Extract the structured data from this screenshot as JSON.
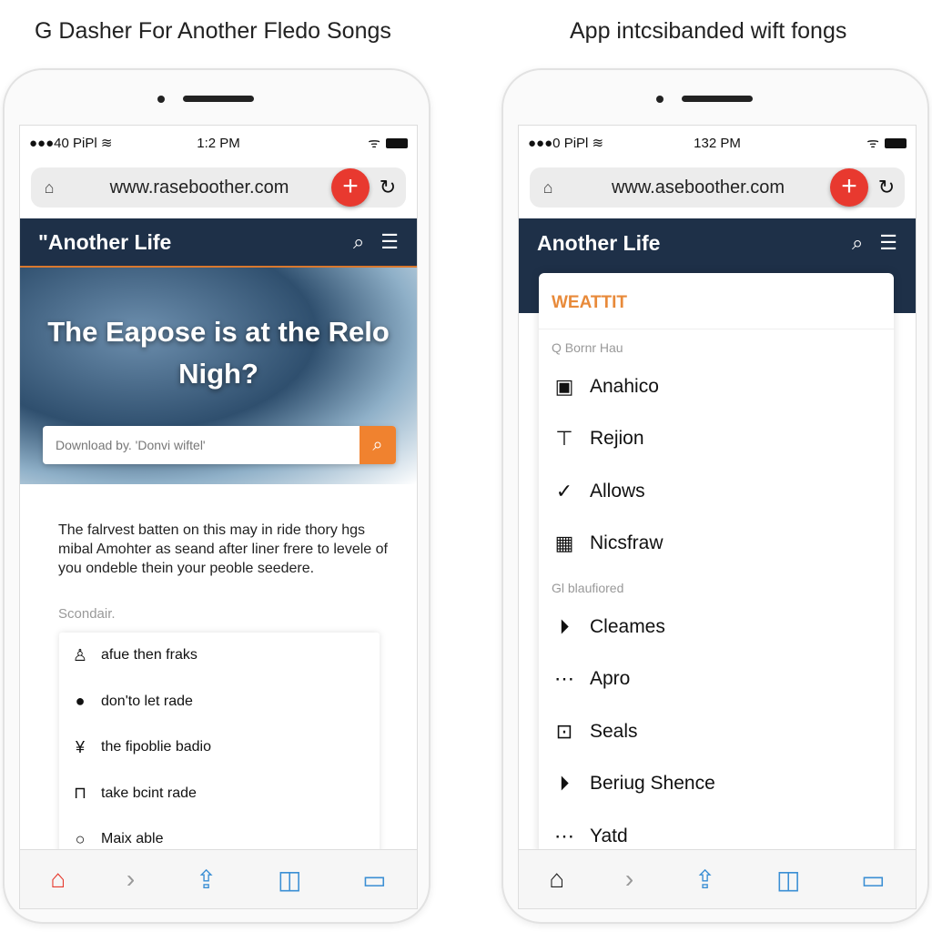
{
  "left": {
    "caption": "G Dasher For Another Fledo Songs",
    "status": {
      "carrier": "●●●40 PiPl",
      "time": "1:2 PM"
    },
    "url": "www.raseboother.com",
    "nav_title": "\"Another Life",
    "hero_title": "The Eapose is at the Relo Nigh?",
    "search_placeholder": "Download by. 'Donvi wiftel'",
    "paragraph": "The falrvest batten on this may in ride thory hgs mibal Amohter as seand after liner frere to levele of you ondeble thein your peoble seedere.",
    "secondary": "Scondair.",
    "items": [
      {
        "label": "afue then fraks",
        "icon": "user-icon"
      },
      {
        "label": "don'to let rade",
        "icon": "pin-icon"
      },
      {
        "label": "the fipoblie badio",
        "icon": "antenna-icon"
      },
      {
        "label": "take bcint rade",
        "icon": "stand-icon"
      },
      {
        "label": "Maix able",
        "icon": "circle-icon"
      }
    ]
  },
  "right": {
    "caption": "App intcsibanded wift fongs",
    "status": {
      "carrier": "●●●0 PiPl",
      "time": "132 PM"
    },
    "url": "www.aseboother.com",
    "nav_title": "Another Life",
    "menu_header": "WEATTIT",
    "section1": "Q Bornr Hau",
    "section1_items": [
      {
        "label": "Anahico",
        "icon": "app-icon"
      },
      {
        "label": "Rejion",
        "icon": "table-icon"
      },
      {
        "label": "Allows",
        "icon": "check-circle-icon"
      },
      {
        "label": "Nicsfraw",
        "icon": "image-icon"
      }
    ],
    "section2": "Gl blaufiored",
    "section2_items": [
      {
        "label": "Cleames",
        "icon": "play-icon"
      },
      {
        "label": "Apro",
        "icon": "more-circle-icon"
      },
      {
        "label": "Seals",
        "icon": "bracket-icon"
      },
      {
        "label": "Beriug Shence",
        "icon": "play-icon"
      },
      {
        "label": "Yatd",
        "icon": "more-circle-icon"
      }
    ]
  },
  "colors": {
    "nav": "#1e3048",
    "accent_red": "#e8392f",
    "accent_orange": "#f0822f",
    "toolbar_blue": "#3b8fd4"
  }
}
